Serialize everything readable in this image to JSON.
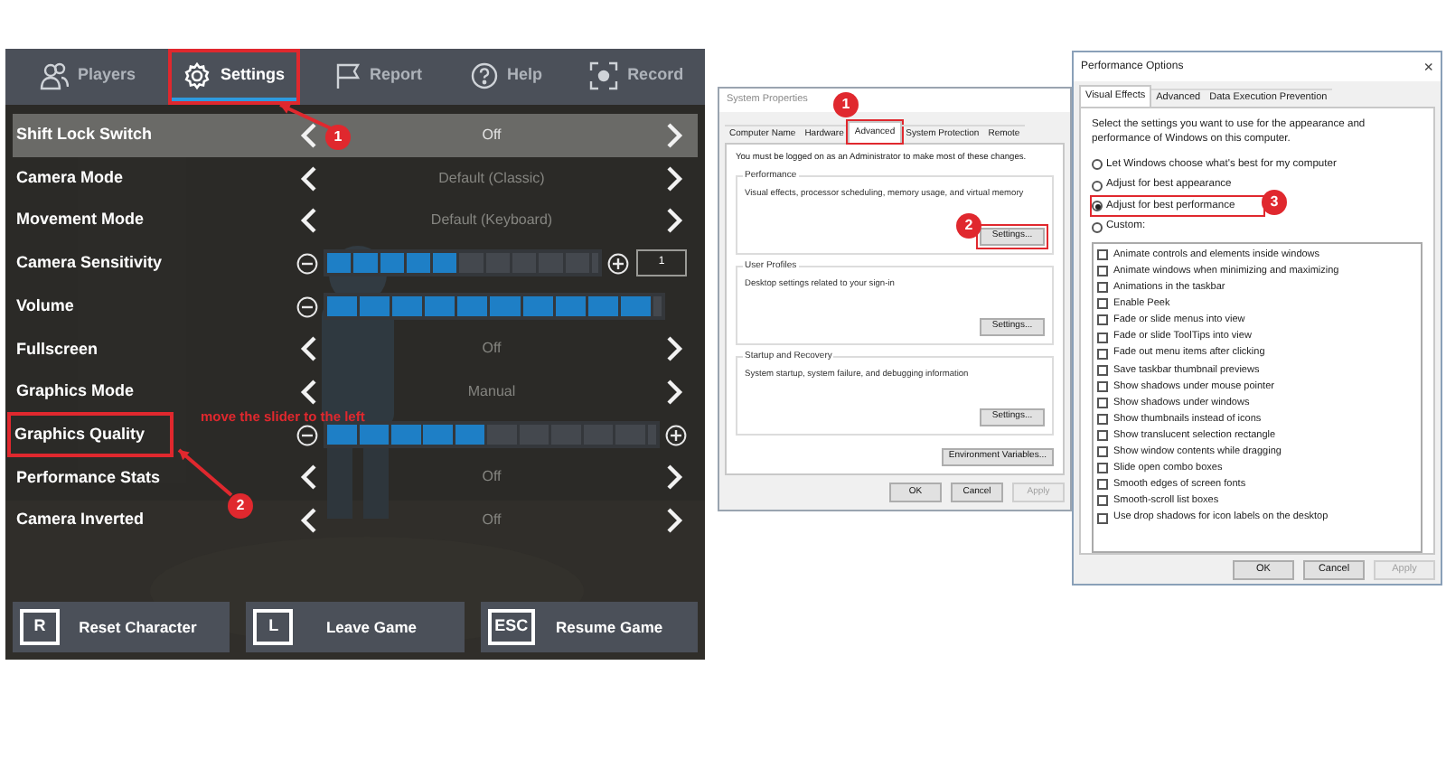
{
  "game_menu": {
    "tabs": [
      {
        "label": "Players",
        "selected": false,
        "highlighted": false
      },
      {
        "label": "Settings",
        "selected": true,
        "highlighted": true
      },
      {
        "label": "Report",
        "selected": false,
        "highlighted": false
      },
      {
        "label": "Help",
        "selected": false,
        "highlighted": false
      },
      {
        "label": "Record",
        "selected": false,
        "highlighted": false
      }
    ],
    "rows": [
      {
        "kind": "selector",
        "label": "Shift Lock Switch",
        "value": "Off",
        "selected": true,
        "highlighted": false
      },
      {
        "kind": "selector",
        "label": "Camera Mode",
        "value": "Default (Classic)",
        "selected": false,
        "highlighted": false
      },
      {
        "kind": "selector",
        "label": "Movement Mode",
        "value": "Default (Keyboard)",
        "selected": false,
        "highlighted": false
      },
      {
        "kind": "slider",
        "label": "Camera Sensitivity",
        "level": 0.5,
        "plus": true,
        "value": "1",
        "selected": false,
        "highlighted": false
      },
      {
        "kind": "slider",
        "label": "Volume",
        "level": 1,
        "plus": false,
        "selected": false,
        "highlighted": false
      },
      {
        "kind": "selector",
        "label": "Fullscreen",
        "value": "Off",
        "selected": false,
        "highlighted": false
      },
      {
        "kind": "selector",
        "label": "Graphics Mode",
        "value": "Manual",
        "selected": false,
        "highlighted": false
      },
      {
        "kind": "slider",
        "label": "Graphics Quality",
        "level": 0.5,
        "plus": true,
        "selected": false,
        "highlighted": true
      },
      {
        "kind": "selector",
        "label": "Performance Stats",
        "value": "Off",
        "selected": false,
        "highlighted": false
      },
      {
        "kind": "selector",
        "label": "Camera Inverted",
        "value": "Off",
        "selected": false,
        "highlighted": false
      }
    ],
    "hint": "move the slider to the left",
    "callouts": [
      "1",
      "2"
    ],
    "buttons": [
      {
        "key": "R",
        "label": "Reset Character"
      },
      {
        "key": "L",
        "label": "Leave Game"
      },
      {
        "key": "ESC",
        "label": "Resume Game"
      }
    ]
  },
  "system_properties": {
    "title": "System Properties",
    "tabs": [
      {
        "label": "Computer Name",
        "selected": false,
        "highlighted": false
      },
      {
        "label": "Hardware",
        "selected": false,
        "highlighted": false
      },
      {
        "label": "Advanced",
        "selected": true,
        "highlighted": true
      },
      {
        "label": "System Protection",
        "selected": false,
        "highlighted": false
      },
      {
        "label": "Remote",
        "selected": false,
        "highlighted": false
      }
    ],
    "notice": "You must be logged on as an Administrator to make most of these changes.",
    "groups": [
      {
        "title": "Performance",
        "description": "Visual effects, processor scheduling, memory usage, and virtual memory",
        "button": "Settings...",
        "highlighted": true
      },
      {
        "title": "User Profiles",
        "description": "Desktop settings related to your sign-in",
        "button": "Settings...",
        "highlighted": false
      },
      {
        "title": "Startup and Recovery",
        "description": "System startup, system failure, and debugging information",
        "button": "Settings...",
        "highlighted": false
      }
    ],
    "env_button": "Environment Variables...",
    "callouts": [
      "1",
      "2"
    ],
    "buttons": [
      {
        "label": "OK",
        "disabled": false
      },
      {
        "label": "Cancel",
        "disabled": false
      },
      {
        "label": "Apply",
        "disabled": true
      }
    ]
  },
  "performance_options": {
    "title": "Performance Options",
    "close": "×",
    "tabs": [
      {
        "label": "Visual Effects",
        "selected": true
      },
      {
        "label": "Advanced",
        "selected": false
      },
      {
        "label": "Data Execution Prevention",
        "selected": false
      }
    ],
    "intro": "Select the settings you want to use for the appearance and performance of Windows on this computer.",
    "options": [
      {
        "label": "Let Windows choose what's best for my computer",
        "selected": false,
        "highlighted": false
      },
      {
        "label": "Adjust for best appearance",
        "selected": false,
        "highlighted": false
      },
      {
        "label": "Adjust for best performance",
        "selected": true,
        "highlighted": true
      },
      {
        "label": "Custom:",
        "selected": false,
        "highlighted": false
      }
    ],
    "callouts": [
      "3"
    ],
    "effects": [
      {
        "label": "Animate controls and elements inside windows",
        "checked": false
      },
      {
        "label": "Animate windows when minimizing and maximizing",
        "checked": false
      },
      {
        "label": "Animations in the taskbar",
        "checked": false
      },
      {
        "label": "Enable Peek",
        "checked": false
      },
      {
        "label": "Fade or slide menus into view",
        "checked": false
      },
      {
        "label": "Fade or slide ToolTips into view",
        "checked": false
      },
      {
        "label": "Fade out menu items after clicking",
        "checked": false
      },
      {
        "label": "Save taskbar thumbnail previews",
        "checked": false
      },
      {
        "label": "Show shadows under mouse pointer",
        "checked": false
      },
      {
        "label": "Show shadows under windows",
        "checked": false
      },
      {
        "label": "Show thumbnails instead of icons",
        "checked": false
      },
      {
        "label": "Show translucent selection rectangle",
        "checked": false
      },
      {
        "label": "Show window contents while dragging",
        "checked": false
      },
      {
        "label": "Slide open combo boxes",
        "checked": false
      },
      {
        "label": "Smooth edges of screen fonts",
        "checked": false
      },
      {
        "label": "Smooth-scroll list boxes",
        "checked": false
      },
      {
        "label": "Use drop shadows for icon labels on the desktop",
        "checked": false
      }
    ],
    "buttons": [
      {
        "label": "OK",
        "disabled": false
      },
      {
        "label": "Cancel",
        "disabled": false
      },
      {
        "label": "Apply",
        "disabled": true
      }
    ]
  }
}
